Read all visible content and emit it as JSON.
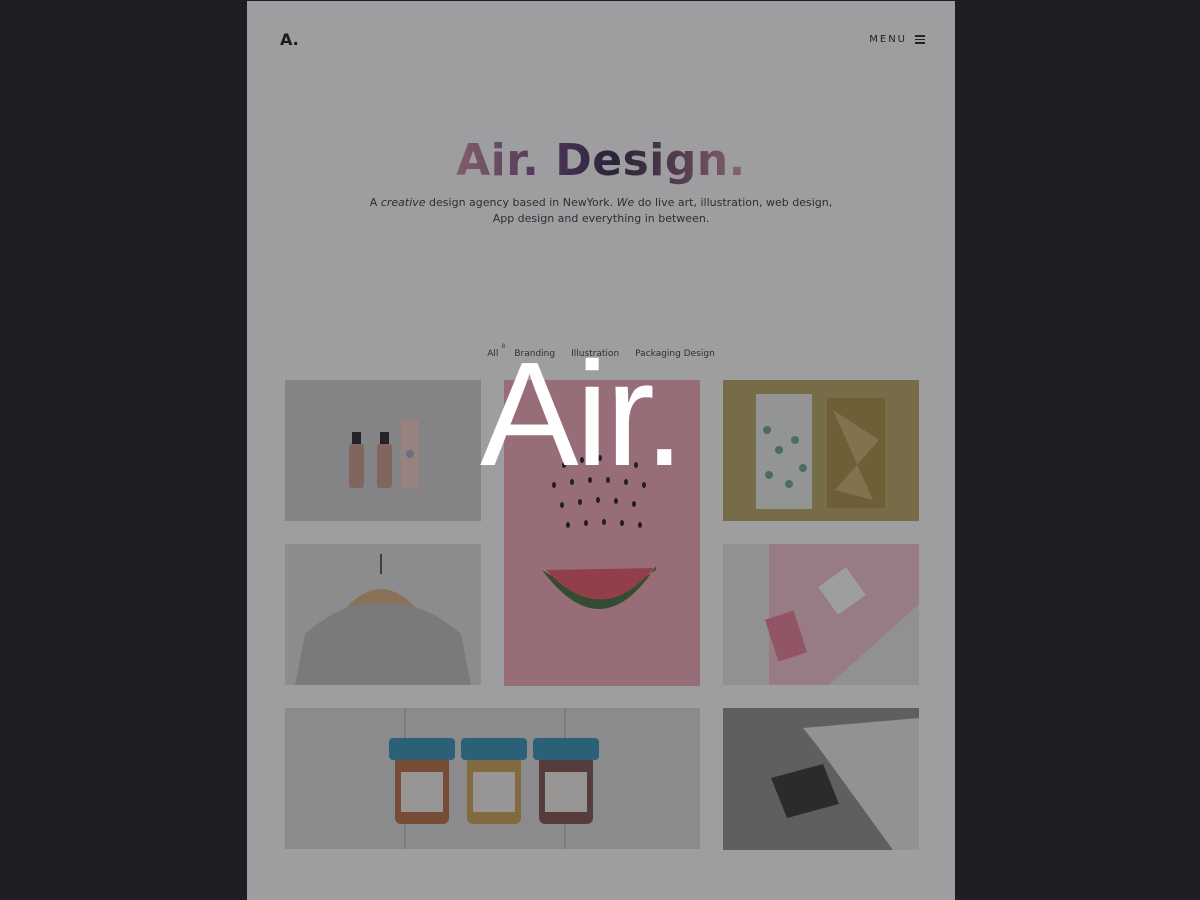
{
  "header": {
    "logo": "A.",
    "menu_label": "MENU",
    "menu_icon": "hamburger-icon"
  },
  "hero": {
    "title": "Air. Design.",
    "desc_1": "A ",
    "desc_em1": "creative",
    "desc_2": " design agency based in NewYork. ",
    "desc_em2": "We",
    "desc_3": " do live art, illustration, web design,",
    "desc_line2": "App design and everything in between."
  },
  "filters": {
    "all": "All",
    "all_count": "8",
    "branding": "Branding",
    "illustration": "Illustration",
    "packaging": "Packaging Design"
  },
  "splash": {
    "logo": "Air."
  },
  "colors": {
    "page_bg": "#ffffff",
    "outer_bg": "#1e1e24",
    "overlay": "rgba(40,40,46,0.45)",
    "title_gradient": [
      "#c98a9a",
      "#6b3f7b",
      "#2d1f3d",
      "#d69aa5"
    ],
    "watermelon_bg": "#f2a6b2",
    "chocolate_bg": "#b7a257",
    "cards_pink": "#f6b6c6"
  }
}
